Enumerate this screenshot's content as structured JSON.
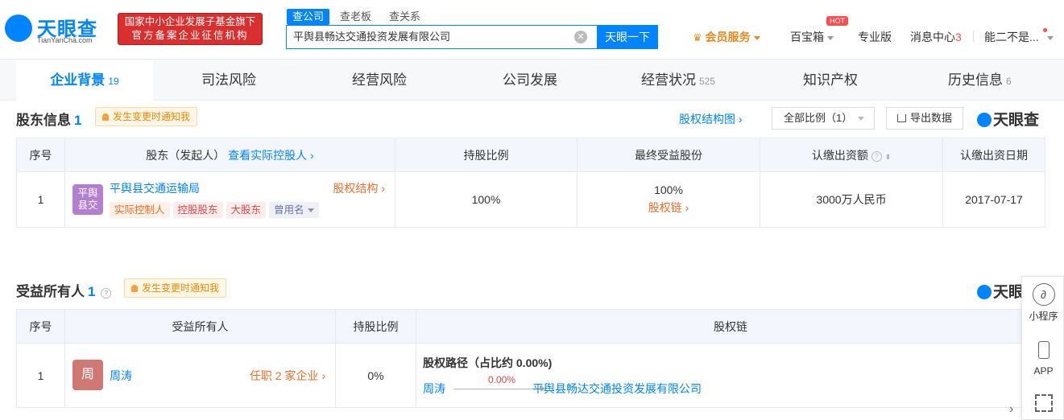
{
  "header": {
    "logo_text": "天眼查",
    "logo_sub": "TianYanCha.com",
    "badge_line1": "国家中小企业发展子基金旗下",
    "badge_line2": "官方备案企业征信机构",
    "search_tabs": [
      "查公司",
      "查老板",
      "查关系"
    ],
    "search_value": "平舆县畅达交通投资发展有限公司",
    "search_button": "天眼一下",
    "nav": {
      "vip": "会员服务",
      "treasure": "百宝箱",
      "hot": "HOT",
      "pro": "专业版",
      "messages": "消息中心",
      "messages_count": "3",
      "user": "能二不是..."
    }
  },
  "tabs": [
    {
      "label": "企业背景",
      "count": "19"
    },
    {
      "label": "司法风险",
      "count": ""
    },
    {
      "label": "经营风险",
      "count": ""
    },
    {
      "label": "公司发展",
      "count": ""
    },
    {
      "label": "经营状况",
      "count": "525"
    },
    {
      "label": "知识产权",
      "count": ""
    },
    {
      "label": "历史信息",
      "count": "6"
    }
  ],
  "shareholders": {
    "title": "股东信息",
    "count": "1",
    "notify": "发生变更时通知我",
    "structure_link": "股权结构图",
    "ratio_filter": "全部比例（1）",
    "export": "导出数据",
    "watermark": "天眼查",
    "columns": [
      "序号",
      "股东（发起人）",
      "查看实际控股人",
      "持股比例",
      "最终受益股份",
      "认缴出资额",
      "认缴出资日期"
    ],
    "rows": [
      {
        "index": "1",
        "avatar": "平舆县交",
        "name": "平舆县交通运输局",
        "structure": "股权结构",
        "tags": [
          "实际控制人",
          "控股股东",
          "大股东",
          "曾用名"
        ],
        "ratio": "100%",
        "final_ratio": "100%",
        "chain": "股权链",
        "capital": "3000万人民币",
        "date": "2017-07-17"
      }
    ]
  },
  "beneficiaries": {
    "title": "受益所有人",
    "count": "1",
    "notify": "发生变更时通知我",
    "watermark": "天眼",
    "columns": [
      "序号",
      "受益所有人",
      "持股比例",
      "股权链"
    ],
    "rows": [
      {
        "index": "1",
        "avatar": "周",
        "name": "周涛",
        "positions": "任职 2 家企业",
        "ratio": "0%",
        "path_title": "股权路径（占比约 0.00%)",
        "path_from": "周涛",
        "path_pct": "0.00%",
        "path_to": "平舆县畅达交通投资发展有限公司"
      }
    ]
  },
  "float_panel": {
    "mini_program": "小程序",
    "app": "APP"
  },
  "colors": {
    "brand": "#0084ff",
    "orange": "#e8702a",
    "red_badge": "#d92f2f"
  }
}
